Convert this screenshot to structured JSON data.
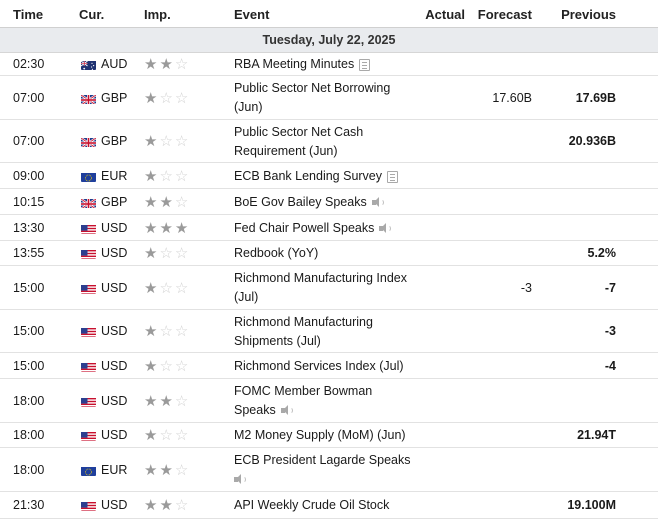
{
  "header": {
    "time": "Time",
    "currency": "Cur.",
    "importance": "Imp.",
    "event": "Event",
    "actual": "Actual",
    "forecast": "Forecast",
    "previous": "Previous"
  },
  "date_label": "Tuesday, July 22, 2025",
  "events": [
    {
      "time": "02:30",
      "flag": "au-flag-icon",
      "currency": "AUD",
      "importance": 2,
      "event_lines": [
        "RBA Meeting Minutes"
      ],
      "icon": "document-icon",
      "actual": "",
      "forecast": "",
      "previous": ""
    },
    {
      "time": "07:00",
      "flag": "gb-flag-icon",
      "currency": "GBP",
      "importance": 1,
      "event_lines": [
        "Public Sector Net Borrowing",
        "(Jun)"
      ],
      "icon": "",
      "actual": "",
      "forecast": "17.60B",
      "previous": "17.69B"
    },
    {
      "time": "07:00",
      "flag": "gb-flag-icon",
      "currency": "GBP",
      "importance": 1,
      "event_lines": [
        "Public Sector Net Cash",
        "Requirement (Jun)"
      ],
      "icon": "",
      "actual": "",
      "forecast": "",
      "previous": "20.936B"
    },
    {
      "time": "09:00",
      "flag": "eu-flag-icon",
      "currency": "EUR",
      "importance": 1,
      "event_lines": [
        "ECB Bank Lending Survey"
      ],
      "icon": "document-icon",
      "actual": "",
      "forecast": "",
      "previous": ""
    },
    {
      "time": "10:15",
      "flag": "gb-flag-icon",
      "currency": "GBP",
      "importance": 2,
      "event_lines": [
        "BoE Gov Bailey Speaks"
      ],
      "icon": "speaker-icon",
      "actual": "",
      "forecast": "",
      "previous": ""
    },
    {
      "time": "13:30",
      "flag": "us-flag-icon",
      "currency": "USD",
      "importance": 3,
      "event_lines": [
        "Fed Chair Powell Speaks"
      ],
      "icon": "speaker-icon",
      "actual": "",
      "forecast": "",
      "previous": ""
    },
    {
      "time": "13:55",
      "flag": "us-flag-icon",
      "currency": "USD",
      "importance": 1,
      "event_lines": [
        "Redbook (YoY)"
      ],
      "icon": "",
      "actual": "",
      "forecast": "",
      "previous": "5.2%"
    },
    {
      "time": "15:00",
      "flag": "us-flag-icon",
      "currency": "USD",
      "importance": 1,
      "event_lines": [
        "Richmond Manufacturing Index",
        "(Jul)"
      ],
      "icon": "",
      "actual": "",
      "forecast": "-3",
      "previous": "-7"
    },
    {
      "time": "15:00",
      "flag": "us-flag-icon",
      "currency": "USD",
      "importance": 1,
      "event_lines": [
        "Richmond Manufacturing",
        "Shipments (Jul)"
      ],
      "icon": "",
      "actual": "",
      "forecast": "",
      "previous": "-3"
    },
    {
      "time": "15:00",
      "flag": "us-flag-icon",
      "currency": "USD",
      "importance": 1,
      "event_lines": [
        "Richmond Services Index (Jul)"
      ],
      "icon": "",
      "actual": "",
      "forecast": "",
      "previous": "-4"
    },
    {
      "time": "18:00",
      "flag": "us-flag-icon",
      "currency": "USD",
      "importance": 2,
      "event_lines": [
        "FOMC Member Bowman",
        "Speaks"
      ],
      "icon": "speaker-icon",
      "actual": "",
      "forecast": "",
      "previous": ""
    },
    {
      "time": "18:00",
      "flag": "us-flag-icon",
      "currency": "USD",
      "importance": 1,
      "event_lines": [
        "M2 Money Supply (MoM) (Jun)"
      ],
      "icon": "",
      "actual": "",
      "forecast": "",
      "previous": "21.94T"
    },
    {
      "time": "18:00",
      "flag": "eu-flag-icon",
      "currency": "EUR",
      "importance": 2,
      "event_lines": [
        "ECB President Lagarde Speaks",
        ""
      ],
      "icon": "speaker-icon",
      "actual": "",
      "forecast": "",
      "previous": ""
    },
    {
      "time": "21:30",
      "flag": "us-flag-icon",
      "currency": "USD",
      "importance": 2,
      "event_lines": [
        "API Weekly Crude Oil Stock"
      ],
      "icon": "",
      "actual": "",
      "forecast": "",
      "previous": "19.100M"
    }
  ]
}
